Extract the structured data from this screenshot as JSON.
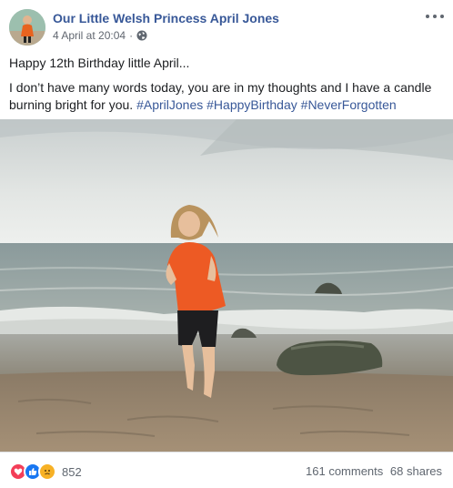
{
  "post": {
    "page_name": "Our Little Welsh Princess April Jones",
    "timestamp": "4 April at 20:04",
    "separator": "·",
    "privacy_icon": "globe-icon",
    "more_icon": "ellipsis-icon",
    "line1": "Happy 12th Birthday little April...",
    "line2": "I don’t have many words today, you are in my thoughts and I have a candle burning bright for you.",
    "hashtags": [
      "#AprilJones",
      "#HappyBirthday",
      "#NeverForgotten"
    ]
  },
  "footer": {
    "reaction_icons": [
      "love-reaction-icon",
      "like-reaction-icon",
      "sad-reaction-icon"
    ],
    "reaction_count": "852",
    "comments": "161 comments",
    "shares": "68 shares"
  },
  "colors": {
    "link": "#385898",
    "love": "#f33e58",
    "like": "#1877f2",
    "sad": "#f7b125"
  }
}
